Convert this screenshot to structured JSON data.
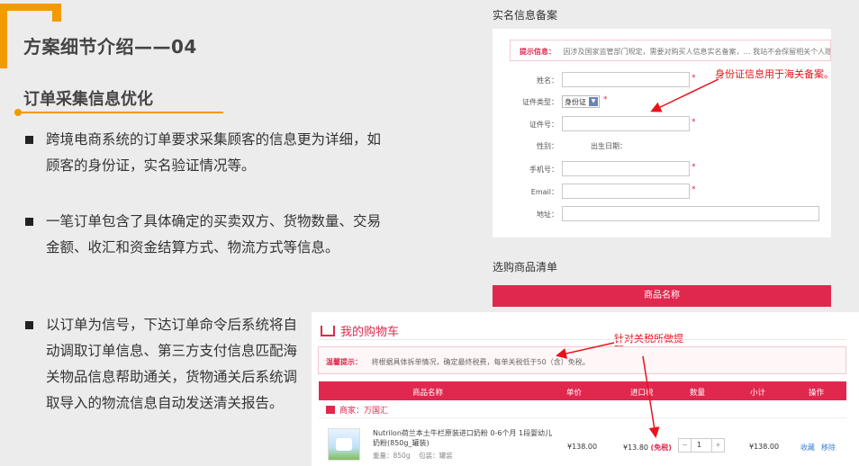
{
  "slide": {
    "title": "方案细节介绍——04",
    "subtitle": "订单采集信息优化",
    "bullets": [
      "跨境电商系统的订单要求采集顾客的信息更为详细，如顾客的身份证，实名验证情况等。",
      "一笔订单包含了具体确定的买卖双方、货物数量、交易金额、收汇和资金结算方式、物流方式等信息。",
      "以订单为信号，下达订单命令后系统将自动调取订单信息、第三方支付信息匹配海关物品信息帮助通关，货物通关后系统调取导入的物流信息自动发送清关报告。"
    ]
  },
  "form": {
    "header": "实名信息备案",
    "tip_label": "提示信息：",
    "tip_text": "因涉及国家监管部门规定，需要对购买人信息实名备案，… 我站不会保留相关个人隐私",
    "fields": {
      "name_label": "姓名：",
      "idtype_label": "证件类型：",
      "idtype_value": "身份证",
      "idno_label": "证件号：",
      "gender_label": "性别：",
      "birth_label": "出生日期：",
      "phone_label": "手机号：",
      "email_label": "Email：",
      "address_label": "地址："
    },
    "required_mark": "*",
    "annotation": "身份证信息用于海关备案。",
    "list_header": "选购商品清单",
    "product_name_bar": "商品名称"
  },
  "cart": {
    "title": "我的购物车",
    "annotation_line1": "针对关税所做提",
    "annotation_line2": "醒。",
    "warn_label": "温馨提示：",
    "warn_text": "将根据具体拆单情况，确定最终税费，每单关税低于50（含）免税。",
    "columns": [
      "商品名称",
      "单价",
      "进口税",
      "数量",
      "小计",
      "操作"
    ],
    "merchant": "商家：万国汇",
    "product": {
      "name": "Nutrilon荷兰本土牛栏原装进口奶粉 0-6个月 1段婴幼儿奶粉(850g_罐装)",
      "meta_weight": "重量：850g",
      "meta_pack": "包装：罐装",
      "price": "¥138.00",
      "tax": "¥13.80",
      "tax_free": "(免税)",
      "qty_minus": "−",
      "qty": "1",
      "qty_plus": "+",
      "subtotal": "¥138.00",
      "action_fav": "收藏",
      "action_remove": "移除"
    }
  },
  "colors": {
    "accent": "#f39a00",
    "brand_red": "#e0284f",
    "annotation_red": "#e8121c"
  }
}
